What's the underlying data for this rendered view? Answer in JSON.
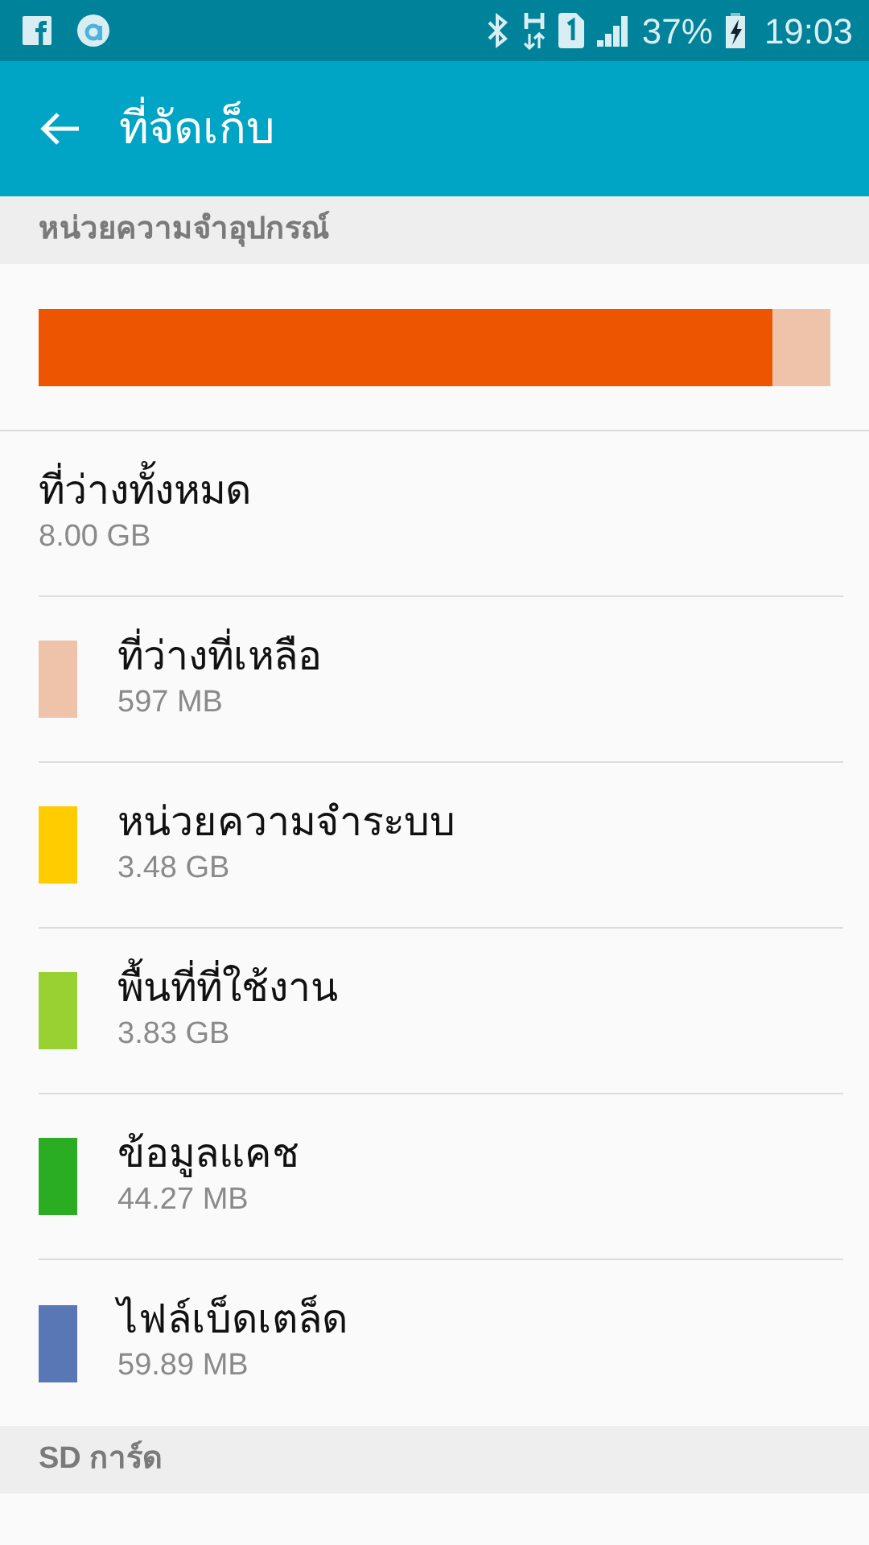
{
  "status_bar": {
    "battery": "37%",
    "time": "19:03"
  },
  "app_bar": {
    "title": "ที่จัดเก็บ"
  },
  "sections": [
    {
      "header": "หน่วยความจำอุปกรณ์",
      "usage_bar": {
        "level": 0.927,
        "color": "#ee5500"
      },
      "total": {
        "label": "ที่ว่างทั้งหมด",
        "value": "8.00 GB"
      },
      "items": [
        {
          "label": "ที่ว่างที่เหลือ",
          "value": "597 MB",
          "color": "#eec3aa"
        },
        {
          "label": "หน่วยความจำระบบ",
          "value": "3.48 GB",
          "color": "#ffcc00"
        },
        {
          "label": "พื้นที่ที่ใช้งาน",
          "value": "3.83 GB",
          "color": "#99d133"
        },
        {
          "label": "ข้อมูลแคช",
          "value": "44.27 MB",
          "color": "#2aad22"
        },
        {
          "label": "ไฟล์เบ็ดเตล็ด",
          "value": "59.89 MB",
          "color": "#5a77b5"
        }
      ]
    },
    {
      "header": "SD การ์ด"
    }
  ]
}
